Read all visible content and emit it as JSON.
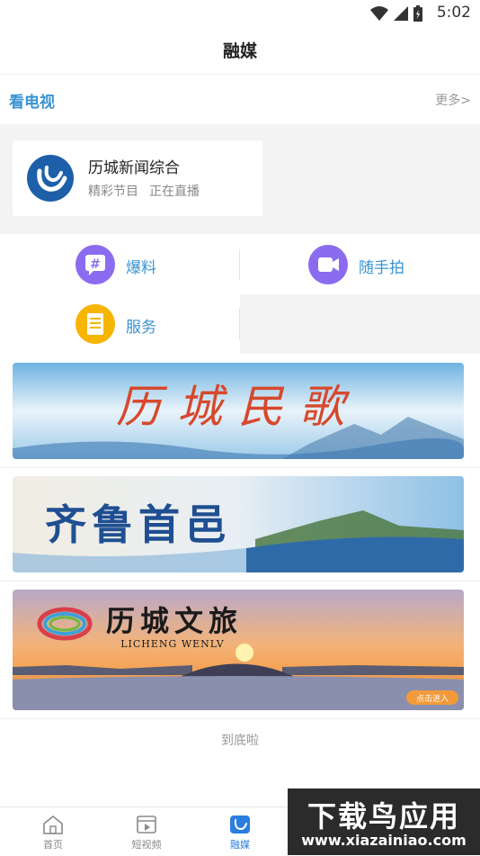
{
  "status_bar": {
    "time": "5:02"
  },
  "header": {
    "title": "融媒"
  },
  "tv": {
    "section_title": "看电视",
    "more_label": "更多>",
    "channel_name": "历城新闻综合",
    "channel_sub_1": "精彩节目",
    "channel_sub_2": "正在直播"
  },
  "services": [
    {
      "label": "爆料",
      "icon": "hashtag-chat-icon",
      "color": "#8b6cf0"
    },
    {
      "label": "随手拍",
      "icon": "video-camera-icon",
      "color": "#8b6cf0"
    },
    {
      "label": "服务",
      "icon": "document-icon",
      "color": "#f7b500"
    }
  ],
  "banners": [
    {
      "title": "历城民歌"
    },
    {
      "title": "齐鲁首邑"
    },
    {
      "title": "历城文旅",
      "subtitle": "LICHENG WENLV",
      "button": "点击进入"
    }
  ],
  "footer_text": "到底啦",
  "bottom_nav": [
    {
      "label": "首页",
      "icon": "home-icon"
    },
    {
      "label": "短视频",
      "icon": "film-icon"
    },
    {
      "label": "融媒",
      "icon": "media-logo-icon",
      "active": true
    }
  ],
  "watermark": {
    "line1": "下载鸟应用",
    "line2": "www.xiazainiao.com"
  },
  "colors": {
    "accent": "#3a93d3",
    "nav_active": "#2b7de0",
    "channel_logo": "#1e5faa"
  }
}
